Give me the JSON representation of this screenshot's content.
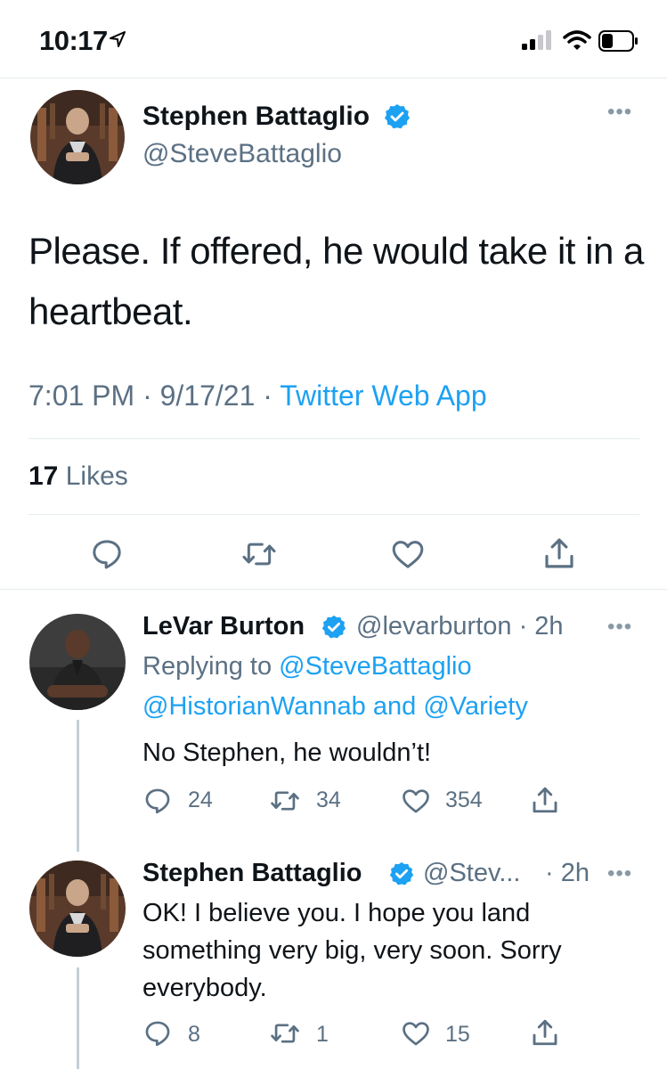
{
  "status_bar": {
    "time": "10:17"
  },
  "main_tweet": {
    "author_name": "Stephen Battaglio",
    "author_handle": "@SteveBattaglio",
    "more": "•••",
    "text": "Please. If offered, he would take it in a heartbeat.",
    "timestamp": "7:01 PM · 9/17/21 · ",
    "client": "Twitter Web App",
    "likes_count": "17",
    "likes_label": "Likes"
  },
  "replies": [
    {
      "author_name": "LeVar Burton",
      "author_handle": "@levarburton · 2h",
      "more": "•••",
      "replying_prefix": "Replying to ",
      "replying_to_1": "@SteveBattaglio",
      "replying_to_2": "@HistorianWannab",
      "replying_and": " and ",
      "replying_to_3": "@Variety",
      "text": "No Stephen, he wouldn’t!",
      "reply_count": "24",
      "retweet_count": "34",
      "like_count": "354"
    },
    {
      "author_name": "Stephen Battaglio",
      "author_handle": "@Stev...",
      "time": "· 2h",
      "more": "•••",
      "text": "OK! I believe you. I hope you land something very big, very soon. Sorry everybody.",
      "reply_count": "8",
      "retweet_count": "1",
      "like_count": "15"
    }
  ],
  "colors": {
    "accent": "#1da1f2",
    "text_primary": "#0f1419",
    "text_secondary": "#5b7083"
  },
  "icons": [
    "location-arrow-icon",
    "signal-icon",
    "wifi-icon",
    "battery-icon",
    "verified-badge-icon",
    "reply-icon",
    "retweet-icon",
    "like-icon",
    "share-icon"
  ]
}
